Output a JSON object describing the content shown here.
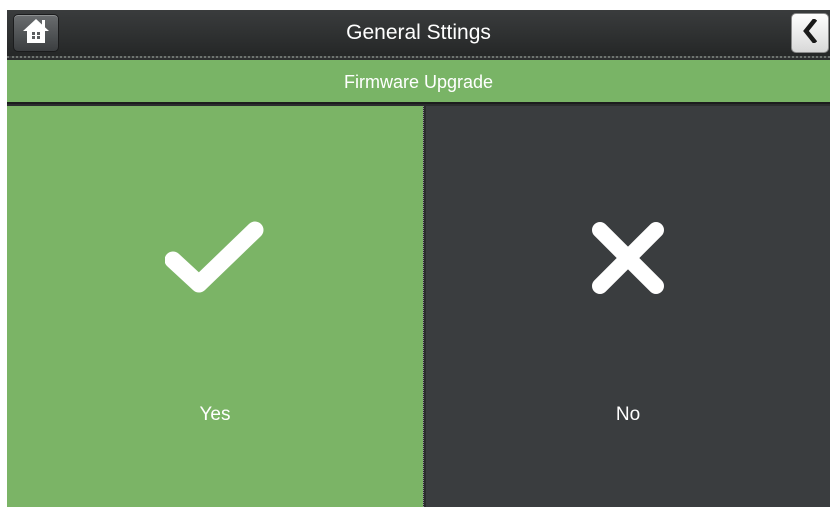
{
  "header": {
    "title": "General Sttings",
    "home_icon": "home-icon",
    "back_icon": "chevron-left-icon"
  },
  "section": {
    "title": "Firmware Upgrade"
  },
  "options": {
    "yes_label": "Yes",
    "yes_icon": "checkmark-icon",
    "no_label": "No",
    "no_icon": "close-icon"
  },
  "colors": {
    "accent_green": "#79b466",
    "dark_panel": "#3a3d3f",
    "header_bg": "#2f3132"
  }
}
